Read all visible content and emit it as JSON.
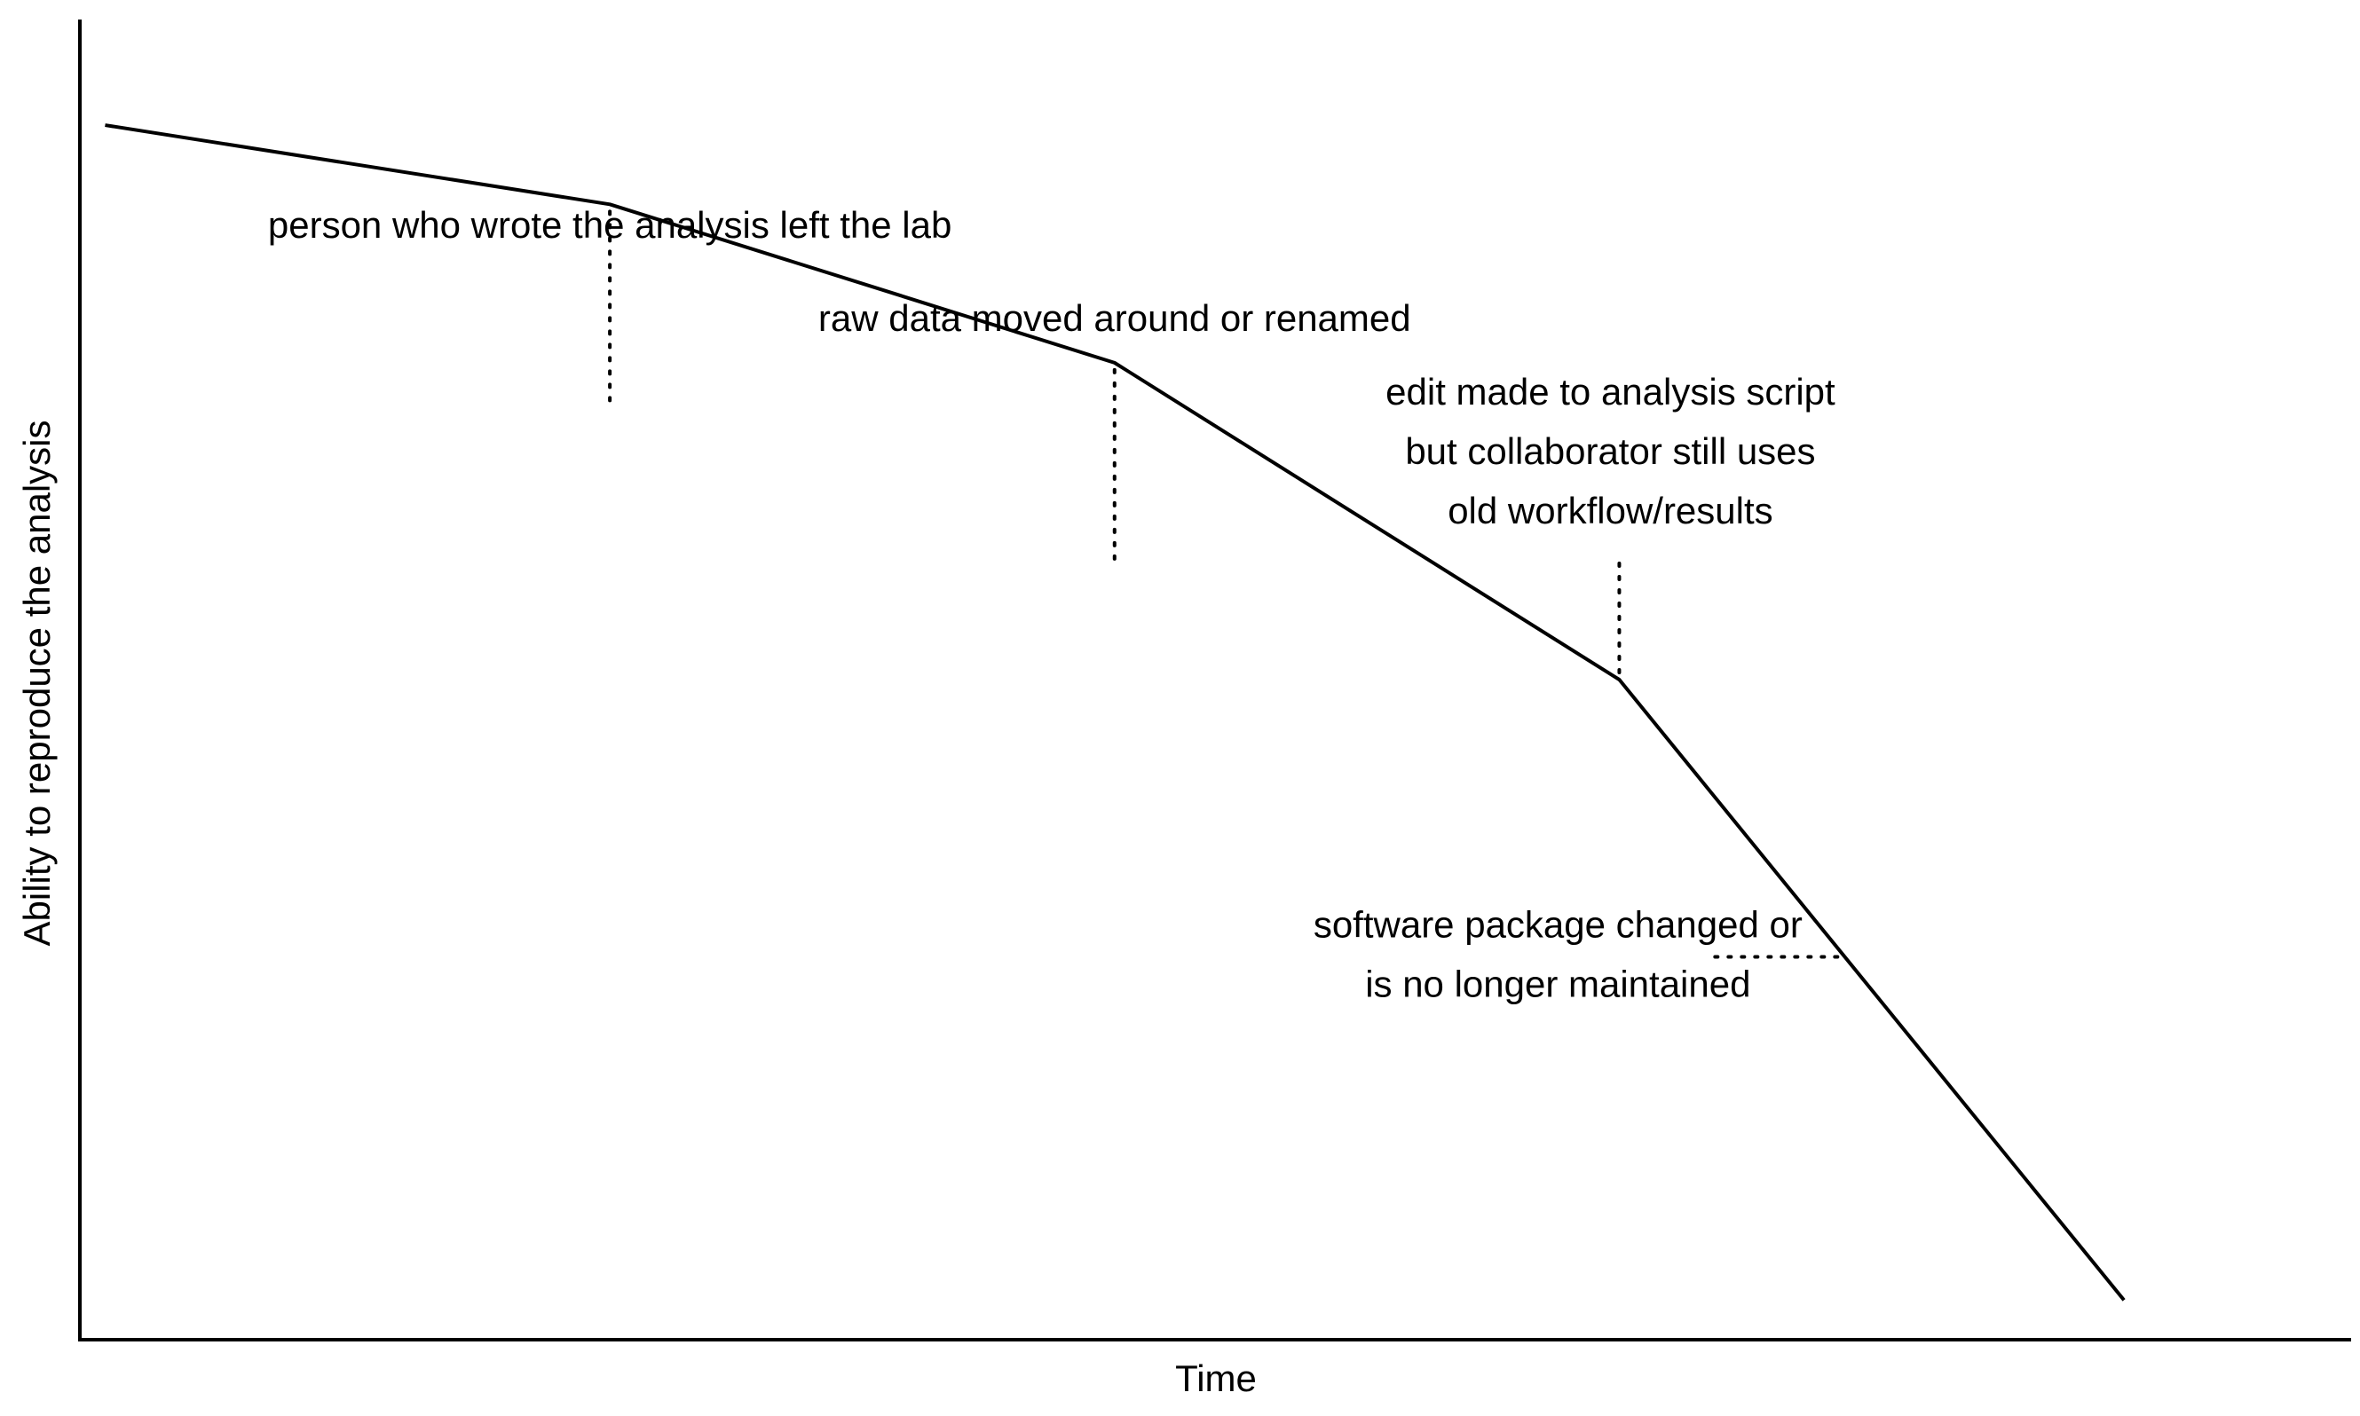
{
  "chart_data": {
    "type": "line",
    "title": "",
    "xlabel": "Time",
    "ylabel": "Ability to reproduce the analysis",
    "x_ticks": false,
    "y_ticks": false,
    "grid": false,
    "series": [
      {
        "points": [
          [
            0.1,
            9.2
          ],
          [
            2.1,
            8.6
          ],
          [
            4.1,
            7.4
          ],
          [
            6.1,
            5.0
          ],
          [
            8.1,
            0.3
          ]
        ]
      }
    ],
    "annotations": [
      {
        "text": [
          "person who wrote the analysis left the lab"
        ],
        "point": [
          2.1,
          8.6
        ],
        "leader": "vertical"
      },
      {
        "text": [
          "raw data moved around or renamed"
        ],
        "point": [
          4.1,
          7.4
        ],
        "leader": "vertical"
      },
      {
        "text": [
          "edit made to analysis script",
          "but collaborator still uses",
          "old workflow/results"
        ],
        "point": [
          6.1,
          5.0
        ],
        "leader": "vertical"
      },
      {
        "text": [
          "software package changed or",
          "is no longer maintained"
        ],
        "point": [
          7.0,
          2.9
        ],
        "leader": "horizontal"
      }
    ],
    "line_color": "#000000"
  }
}
